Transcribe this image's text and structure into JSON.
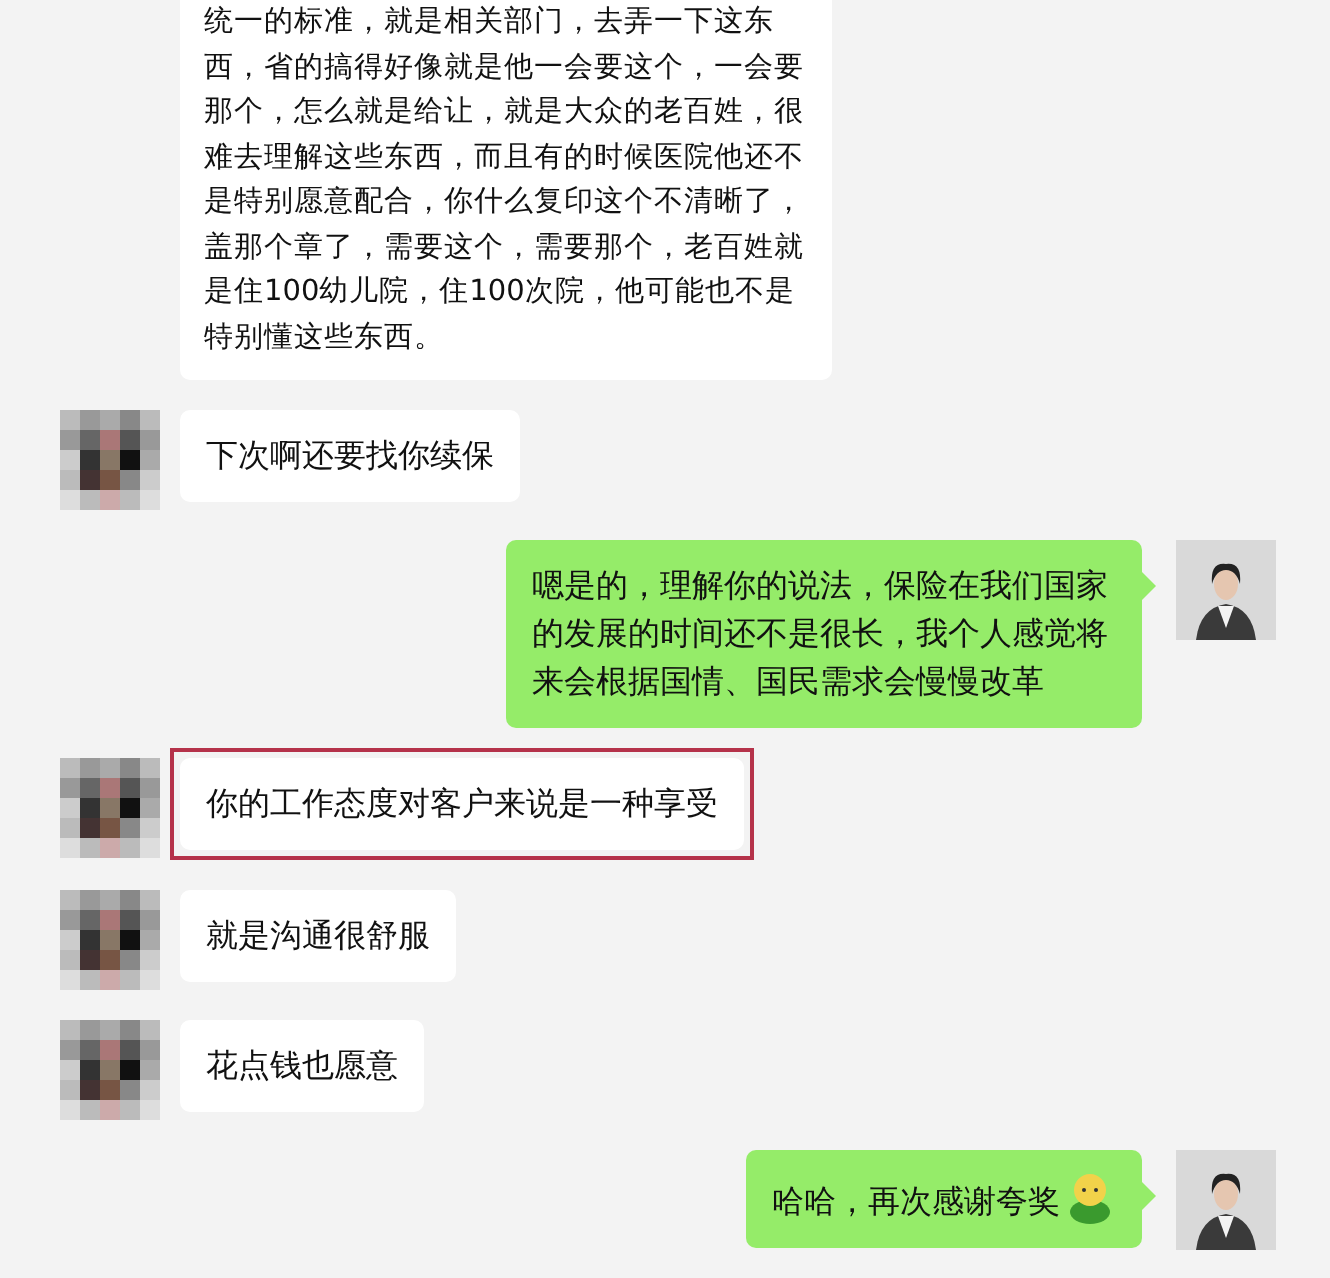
{
  "messages": [
    {
      "kind": "incoming",
      "avatar": false,
      "highlighted": false,
      "text": "统一的标准，就是相关部门，去弄一下这东西，省的搞得好像就是他一会要这个，一会要那个，怎么就是给让，就是大众的老百姓，很难去理解这些东西，而且有的时候医院他还不是特别愿意配合，你什么复印这个不清晰了，盖那个章了，需要这个，需要那个，老百姓就是住100幼儿院，住100次院，他可能也不是特别懂这些东西。"
    },
    {
      "kind": "incoming",
      "avatar": true,
      "highlighted": false,
      "text": "下次啊还要找你续保"
    },
    {
      "kind": "outgoing",
      "avatar": true,
      "highlighted": false,
      "text": "嗯是的，理解你的说法，保险在我们国家的发展的时间还不是很长，我个人感觉将来会根据国情、国民需求会慢慢改革"
    },
    {
      "kind": "incoming",
      "avatar": true,
      "highlighted": true,
      "text": "你的工作态度对客户来说是一种享受"
    },
    {
      "kind": "incoming",
      "avatar": true,
      "highlighted": false,
      "text": "就是沟通很舒服"
    },
    {
      "kind": "incoming",
      "avatar": true,
      "highlighted": false,
      "text": "花点钱也愿意"
    },
    {
      "kind": "outgoing",
      "avatar": true,
      "highlighted": false,
      "text": "哈哈，再次感谢夸奖",
      "emoji": true
    }
  ]
}
